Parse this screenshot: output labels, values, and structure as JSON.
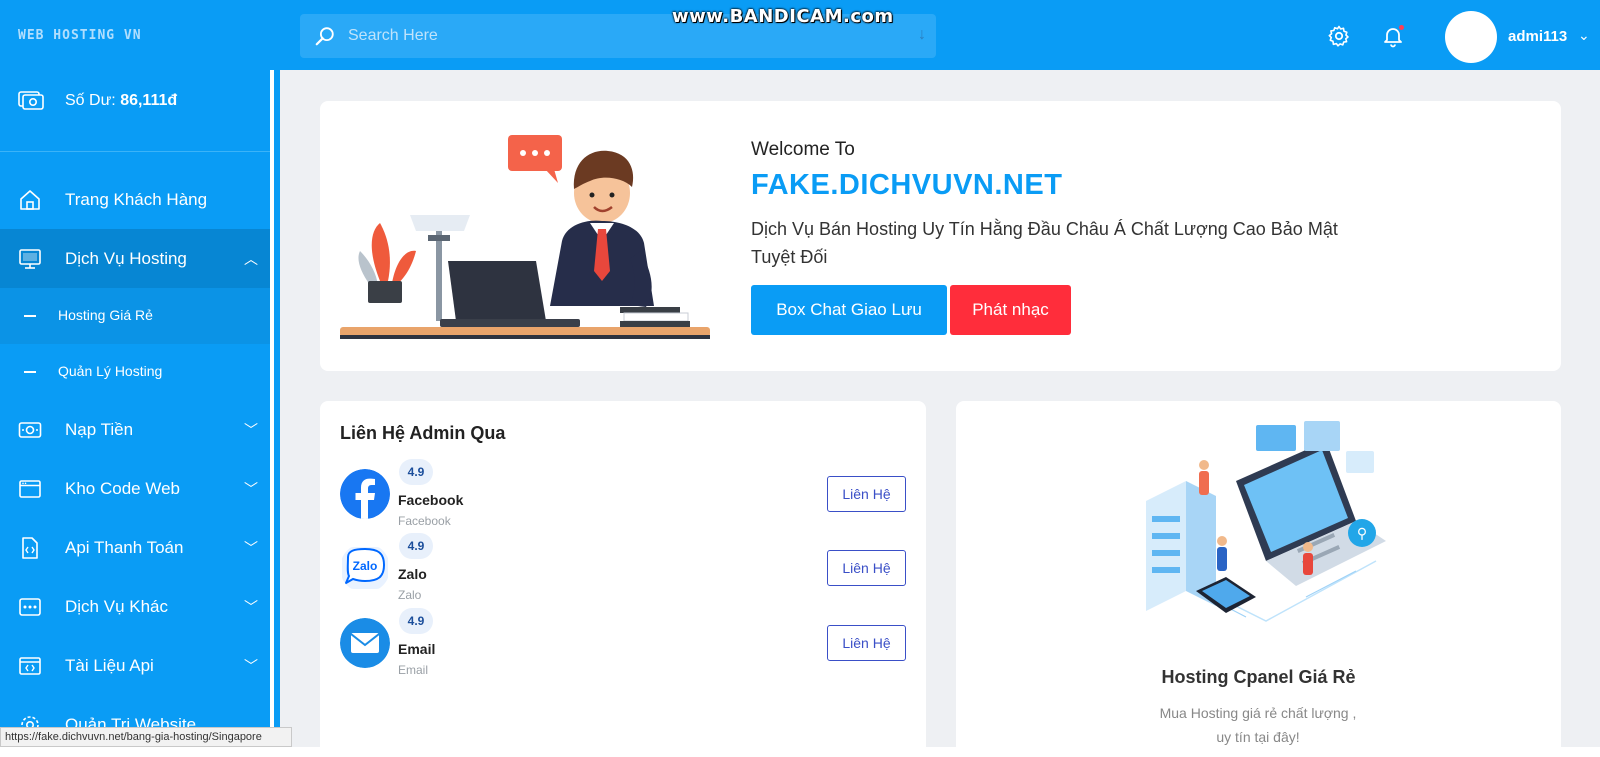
{
  "header": {
    "logo_text": "WEB HOSTING VN",
    "search_placeholder": "Search Here",
    "recorder_watermark": "www.BANDICAM.com",
    "username": "admi113"
  },
  "sidebar": {
    "balance_label": "Số Dư:",
    "balance_value": "86,111đ",
    "items": [
      {
        "label": "Trang Khách Hàng",
        "icon": "home-icon"
      },
      {
        "label": "Dịch Vụ Hosting",
        "icon": "monitor-icon",
        "expanded": true
      },
      {
        "label": "Nạp Tiền",
        "icon": "money-icon"
      },
      {
        "label": "Kho Code Web",
        "icon": "browser-icon"
      },
      {
        "label": "Api Thanh Toán",
        "icon": "file-code-icon"
      },
      {
        "label": "Dịch Vụ Khác",
        "icon": "dots-box-icon"
      },
      {
        "label": "Tài Liệu Api",
        "icon": "code-window-icon"
      },
      {
        "label": "Quản Trị Website",
        "icon": "gear-icon"
      }
    ],
    "sub_items": [
      {
        "label": "Hosting Giá Rẻ"
      },
      {
        "label": "Quản Lý Hosting"
      }
    ]
  },
  "status_bar": {
    "url": "https://fake.dichvuvn.net/bang-gia-hosting/Singapore"
  },
  "welcome": {
    "greeting": "Welcome To",
    "site_name": "FAKE.DICHVUVN.NET",
    "description": "Dịch Vụ Bán Hosting Uy Tín Hằng Đầu Châu Á Chất Lượng Cao Bảo Mật Tuyệt Đối",
    "chat_button": "Box Chat Giao Lưu",
    "music_button": "Phát nhạc"
  },
  "contact": {
    "title": "Liên Hệ Admin Qua",
    "items": [
      {
        "rating": "4.9",
        "name": "Facebook",
        "sub": "Facebook",
        "button": "Liên Hệ"
      },
      {
        "rating": "4.9",
        "name": "Zalo",
        "sub": "Zalo",
        "button": "Liên Hệ",
        "logo_text": "Zalo"
      },
      {
        "rating": "4.9",
        "name": "Email",
        "sub": "Email",
        "button": "Liên Hệ"
      }
    ]
  },
  "hosting": {
    "title": "Hosting Cpanel Giá Rẻ",
    "description": "Mua Hosting giá rẻ chất lượng , uy tín tại đây!"
  },
  "colors": {
    "primary": "#0a9cf5",
    "sidebar_active": "#0786d3",
    "danger": "#ff2d3b",
    "outline_button": "#3a4fc7"
  }
}
